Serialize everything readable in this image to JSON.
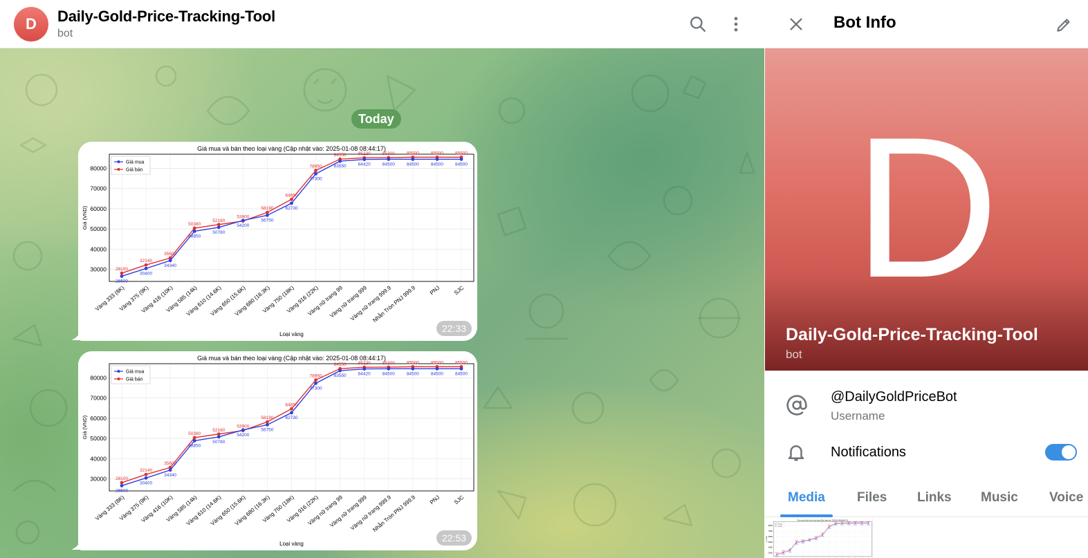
{
  "header": {
    "avatar_letter": "D",
    "title": "Daily-Gold-Price-Tracking-Tool",
    "subtitle": "bot",
    "search_icon": "search-icon",
    "menu_icon": "more-vertical-icon"
  },
  "chat": {
    "date_label": "Today",
    "messages": [
      {
        "time": "22:33"
      },
      {
        "time": "22:53"
      }
    ]
  },
  "panel": {
    "title": "Bot Info",
    "close_icon": "close-icon",
    "edit_icon": "pencil-icon",
    "hero_letter": "D",
    "name": "Daily-Gold-Price-Tracking-Tool",
    "name_sub": "bot",
    "username": "@DailyGoldPriceBot",
    "username_label": "Username",
    "notifications_label": "Notifications",
    "notifications_on": true,
    "tabs": [
      "Media",
      "Files",
      "Links",
      "Music",
      "Voice"
    ],
    "active_tab": "Media"
  },
  "colors": {
    "accent": "#3a8fe3",
    "avatar": "#e0605a",
    "date_pill": "#569652",
    "buy_series": "#2f3fe0",
    "sell_series": "#e03030"
  },
  "chart_data": {
    "type": "line",
    "title": "Giá mua và bán theo loại vàng (Cập nhật vào: 2025-01-08 08:44:17)",
    "xlabel": "Loại vàng",
    "ylabel": "Giá (VND)",
    "categories": [
      "Vàng 333 (8K)",
      "Vàng 375 (9K)",
      "Vàng 416 (10K)",
      "Vàng 585 (14k)",
      "Vàng 610 (14.6K)",
      "Vàng 650 (15.6K)",
      "Vàng 680 (16.3K)",
      "Vàng 750 (18K)",
      "Vàng 916 (22K)",
      "Vàng nữ trang 99",
      "Vàng nữ trang 999",
      "Vàng nữ trang 999.9",
      "Nhẫn Tròn PNJ 999.9",
      "PNJ",
      "SJC"
    ],
    "series": [
      {
        "name": "Giá mua",
        "values": [
          26600,
          30400,
          34340,
          48850,
          50780,
          54200,
          56750,
          62730,
          77300,
          83550,
          84420,
          84500,
          84500,
          84500,
          84500
        ]
      },
      {
        "name": "Giá bán",
        "values": [
          28100,
          32140,
          35600,
          50380,
          52160,
          53900,
          58190,
          64650,
          78950,
          84550,
          85220,
          85300,
          85500,
          85500,
          85500
        ]
      }
    ],
    "yticks": [
      30000,
      40000,
      50000,
      60000,
      70000,
      80000
    ],
    "ylim": [
      24000,
      87000
    ],
    "legend": "top-left",
    "grid": true
  }
}
